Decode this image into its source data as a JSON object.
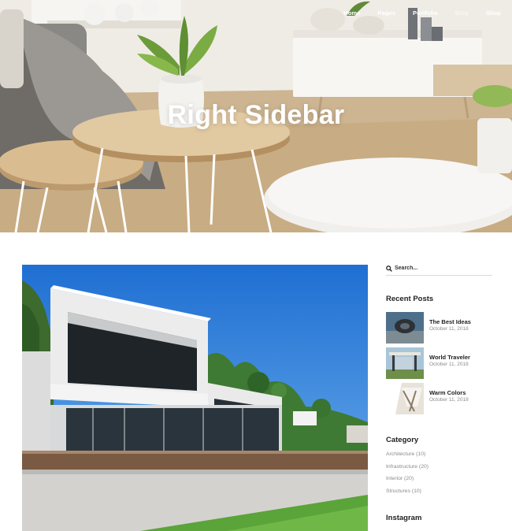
{
  "nav": {
    "items": [
      {
        "label": "Home",
        "active": false
      },
      {
        "label": "Pages",
        "active": false
      },
      {
        "label": "Portfolio",
        "active": false
      },
      {
        "label": "Blog",
        "active": true
      },
      {
        "label": "Shop",
        "active": false
      }
    ]
  },
  "hero": {
    "title": "Right Sidebar"
  },
  "sidebar": {
    "search_placeholder": "Search...",
    "recent_title": "Recent Posts",
    "recent_posts": [
      {
        "title": "The Best Ideas",
        "date": "October 11, 2018"
      },
      {
        "title": "World Traveler",
        "date": "October 11, 2018"
      },
      {
        "title": "Warm Colors",
        "date": "October 11, 2018"
      }
    ],
    "category_title": "Category",
    "categories": [
      "Architecture (10)",
      "Infrastructure (20)",
      "Interior (20)",
      "Structures (10)"
    ],
    "instagram_title": "Instagram"
  },
  "colors": {
    "text": "#222222",
    "muted": "#8a8a8a",
    "sky": "#2f7fd8",
    "grass": "#5aa43a"
  }
}
